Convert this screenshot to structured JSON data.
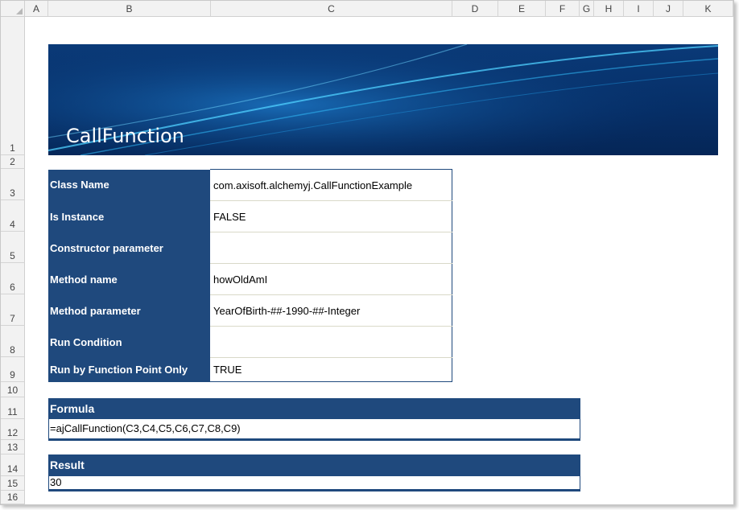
{
  "sheet": {
    "columns": [
      "A",
      "B",
      "C",
      "D",
      "E",
      "F",
      "G",
      "H",
      "I",
      "J",
      "K"
    ],
    "rows": [
      "1",
      "2",
      "3",
      "4",
      "5",
      "6",
      "7",
      "8",
      "9",
      "10",
      "11",
      "12",
      "13",
      "14",
      "15",
      "16"
    ]
  },
  "banner": {
    "title": "CallFunction"
  },
  "properties": [
    {
      "label": "Class Name",
      "value": "com.axisoft.alchemyj.CallFunctionExample"
    },
    {
      "label": "Is Instance",
      "value": "FALSE"
    },
    {
      "label": "Constructor parameter",
      "value": ""
    },
    {
      "label": "Method name",
      "value": "howOldAmI"
    },
    {
      "label": "Method parameter",
      "value": "YearOfBirth-##-1990-##-Integer"
    },
    {
      "label": "Run Condition",
      "value": ""
    },
    {
      "label": "Run by Function Point Only",
      "value": "TRUE"
    }
  ],
  "formula": {
    "header": "Formula",
    "value": "=ajCallFunction(C3,C4,C5,C6,C7,C8,C9)"
  },
  "result": {
    "header": "Result",
    "value": "30"
  },
  "colors": {
    "header_fill": "#1f497d",
    "banner": "#062e66",
    "sheet_header": "#f2f2f2"
  }
}
